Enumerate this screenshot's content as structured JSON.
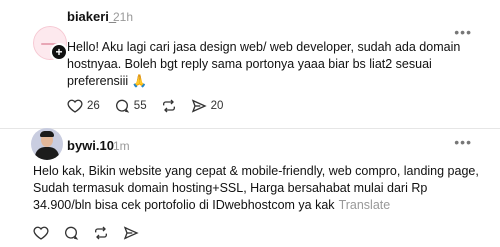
{
  "posts": [
    {
      "username": "biakeri_",
      "time": "21h",
      "text": "Hello! Aku lagi cari jasa design web/ web developer, sudah ada domain hostnyaa. Boleh bgt reply sama portonya yaaa biar bs liat2 sesuai preferensiii 🙏",
      "follow_badge": "+",
      "actions": {
        "like_count": "26",
        "reply_count": "55",
        "repost_count": "",
        "share_count": "20"
      }
    },
    {
      "username": "bywi.10",
      "time": "1m",
      "text": "Helo kak, Bikin website yang cepat & mobile-friendly, web compro, landing page, Sudah termasuk domain hosting+SSL, Harga bersahabat mulai dari Rp 34.900/bln bisa cek portofolio di IDwebhostcom ya kak",
      "translate_label": "Translate"
    }
  ],
  "more_glyph": "•••",
  "icons": [
    "heart-icon",
    "comment-icon",
    "repost-icon",
    "share-icon",
    "more-icon"
  ]
}
